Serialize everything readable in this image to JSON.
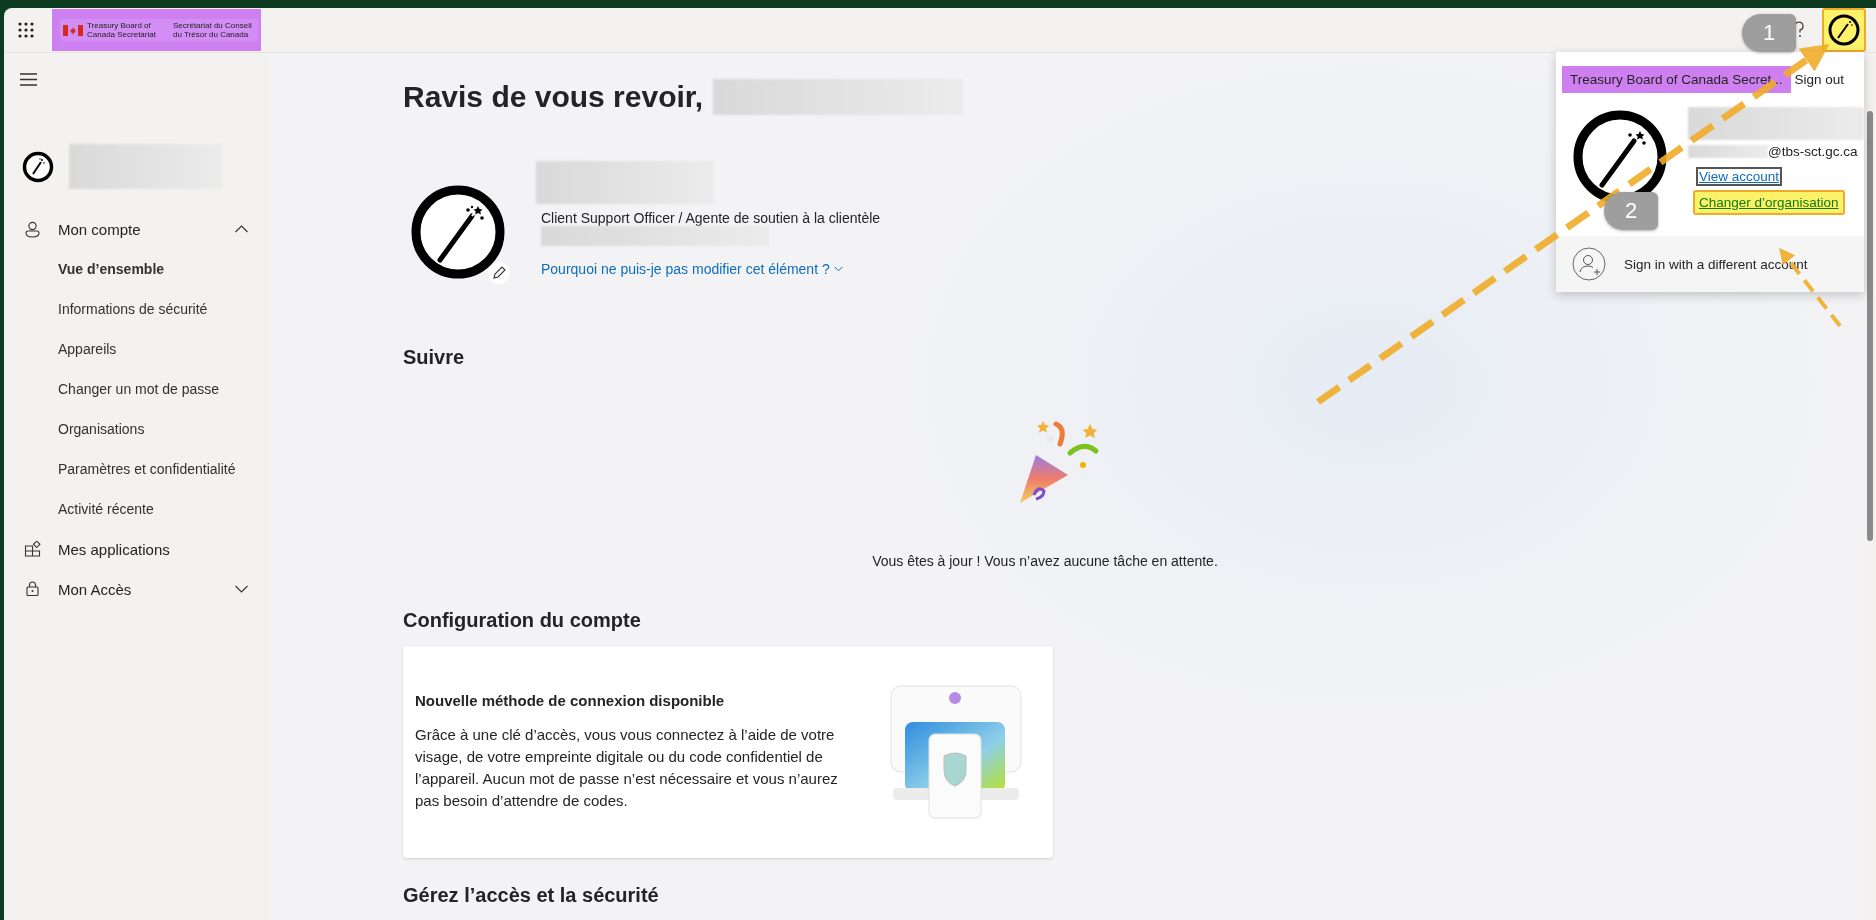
{
  "top_bar": {
    "org_logo": {
      "text_en": "Treasury Board of Canada Secretariat",
      "text_fr": "Secrétariat du Conseil du Trésor du Canada"
    },
    "avatar_button": {
      "highlighted": true
    }
  },
  "sidebar": {
    "items": [
      {
        "label": "Mon compte",
        "expanded": true,
        "children": [
          {
            "label": "Vue d’ensemble",
            "selected": true
          },
          {
            "label": "Informations de sécurité",
            "selected": false
          },
          {
            "label": "Appareils",
            "selected": false
          },
          {
            "label": "Changer un mot de passe",
            "selected": false
          },
          {
            "label": "Organisations",
            "selected": false
          },
          {
            "label": "Paramètres et confidentialité",
            "selected": false
          },
          {
            "label": "Activité récente",
            "selected": false
          }
        ]
      },
      {
        "label": "Mes applications"
      },
      {
        "label": "Mon Accès",
        "expanded": false
      }
    ]
  },
  "main": {
    "greeting": "Ravis de vous revoir,",
    "profile": {
      "job_title": "Client Support Officer / Agente de soutien à la clientèle",
      "edit_link": "Pourquoi ne puis-je pas modifier cet élément ?"
    },
    "sections": [
      {
        "kind": "empty",
        "title": "Suivre",
        "message": "Vous êtes à jour ! Vous n’avez aucune tâche en attente."
      },
      {
        "kind": "card",
        "title": "Configuration du compte",
        "card_title": "Nouvelle méthode de connexion disponible",
        "card_body": "Grâce à une clé d’accès, vous vous connectez à l’aide de votre visage, de votre empreinte digitale ou du code confidentiel de l’appareil. Aucun mot de passe n’est nécessaire et vous n’aurez pas besoin d’attendre de codes."
      },
      {
        "kind": "heading",
        "title": "Gérez l’accès et la sécurité"
      }
    ]
  },
  "account_menu": {
    "organization": "Treasury Board of Canada Secret...",
    "sign_out": "Sign out",
    "email": "@tbs-sct.gc.ca",
    "view_account": "View account",
    "switch_org": {
      "label": "Changer d’organisation",
      "highlighted": true
    },
    "other_account": "Sign in with a different account"
  },
  "annotations": {
    "callouts": [
      {
        "label": "1"
      },
      {
        "label": "2"
      }
    ]
  }
}
